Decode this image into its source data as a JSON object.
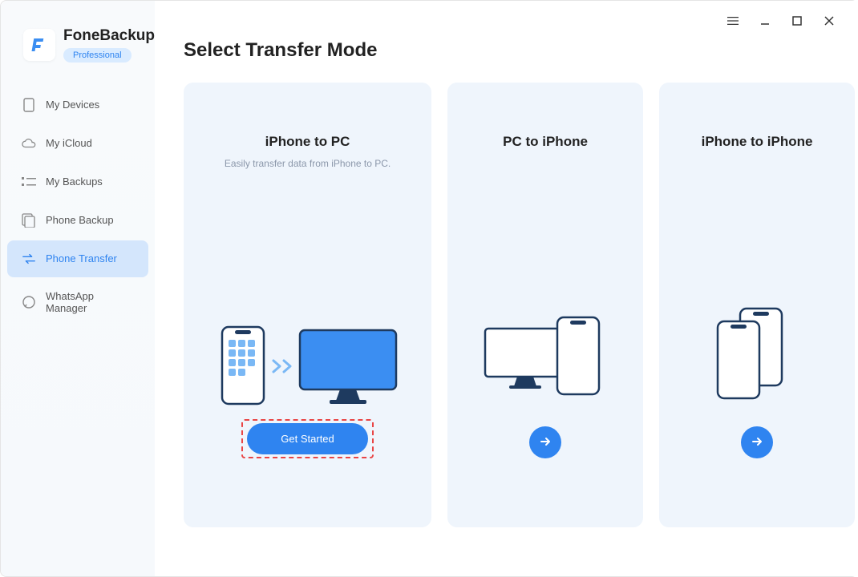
{
  "brand": {
    "name": "FoneBackup",
    "badge": "Professional"
  },
  "sidebar": {
    "items": [
      {
        "label": "My Devices"
      },
      {
        "label": "My iCloud"
      },
      {
        "label": "My Backups"
      },
      {
        "label": "Phone Backup"
      },
      {
        "label": "Phone Transfer"
      },
      {
        "label": "WhatsApp Manager"
      }
    ]
  },
  "main": {
    "title": "Select Transfer Mode",
    "cards": [
      {
        "title": "iPhone to PC",
        "desc": "Easily transfer data from iPhone to PC.",
        "cta": "Get Started"
      },
      {
        "title": "PC to iPhone"
      },
      {
        "title": "iPhone to iPhone"
      }
    ]
  }
}
